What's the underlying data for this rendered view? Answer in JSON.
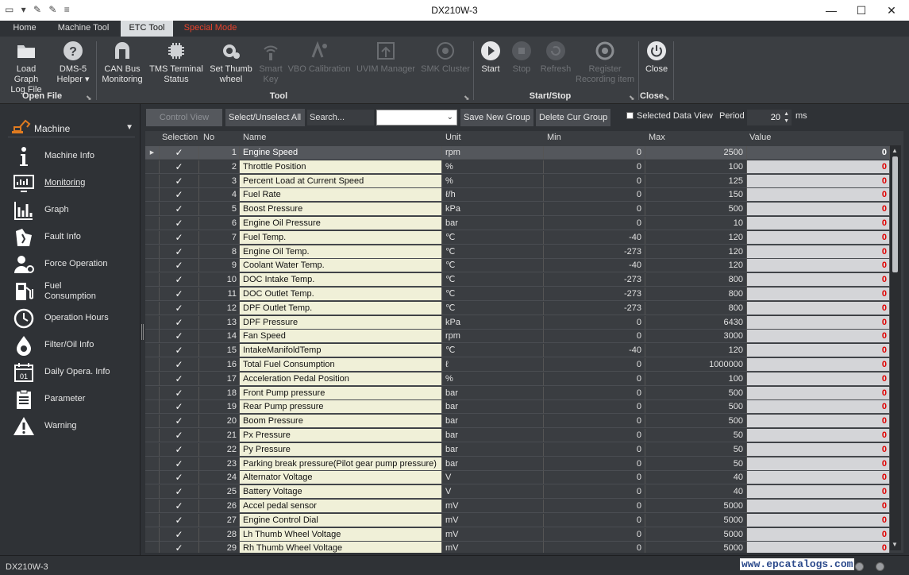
{
  "window": {
    "title": "DX210W-3"
  },
  "tabs": [
    {
      "label": "Home"
    },
    {
      "label": "Machine Tool"
    },
    {
      "label": "ETC Tool"
    },
    {
      "label": "Special Mode"
    }
  ],
  "ribbon": {
    "load_graph": "Load Graph",
    "log_file": "Log File",
    "dms5": "DMS-5",
    "helper": "Helper ▾",
    "can_bus": "CAN Bus",
    "monitoring": "Monitoring",
    "tms_terminal": "TMS Terminal",
    "status": "Status",
    "set_thumb": "Set Thumb",
    "wheel": "wheel",
    "smart": "Smart",
    "key": "Key",
    "vbo_calibration": "VBO Calibration",
    "uvim_manager": "UVIM Manager",
    "smk_cluster": "SMK Cluster",
    "start": "Start",
    "stop": "Stop",
    "refresh": "Refresh",
    "register": "Register",
    "recording_item": "Recording item",
    "close": "Close",
    "group_open_file": "Open File",
    "group_tool": "Tool",
    "group_start_stop": "Start/Stop",
    "group_close": "Close"
  },
  "sidebar": {
    "header": "Machine",
    "items": [
      {
        "label": "Machine Info",
        "icon": "info-icon"
      },
      {
        "label": "Monitoring",
        "icon": "monitor-icon"
      },
      {
        "label": "Graph",
        "icon": "graph-icon"
      },
      {
        "label": "Fault Info",
        "icon": "fault-icon"
      },
      {
        "label": "Force Operation",
        "icon": "user-gear-icon"
      },
      {
        "label": "Fuel",
        "label2": "Consumption",
        "icon": "fuel-icon"
      },
      {
        "label": "Operation Hours",
        "icon": "clock-icon"
      },
      {
        "label": "Filter/Oil Info",
        "icon": "oil-drop-icon"
      },
      {
        "label": "Daily Opera. Info",
        "icon": "calendar-icon"
      },
      {
        "label": "Parameter",
        "icon": "clipboard-icon"
      },
      {
        "label": "Warning",
        "icon": "warning-icon"
      }
    ]
  },
  "toolbar": {
    "control_view": "Control View",
    "select_all": "Select/Unselect All",
    "search_placeholder": "Search...",
    "save_group": "Save New Group",
    "delete_group": "Delete Cur Group",
    "selected_data_view": "Selected Data View",
    "period_label": "Period",
    "period_value": "20",
    "period_unit": "ms"
  },
  "grid": {
    "headers": {
      "selection": "Selection",
      "no": "No",
      "name": "Name",
      "unit": "Unit",
      "min": "Min",
      "max": "Max",
      "value": "Value"
    },
    "check": "✓",
    "rows": [
      {
        "no": "1",
        "name": "Engine Speed",
        "unit": "rpm",
        "min": "0",
        "max": "2500",
        "value": "0"
      },
      {
        "no": "2",
        "name": "Throttle Position",
        "unit": "%",
        "min": "0",
        "max": "100",
        "value": "0"
      },
      {
        "no": "3",
        "name": "Percent Load at Current Speed",
        "unit": "%",
        "min": "0",
        "max": "125",
        "value": "0"
      },
      {
        "no": "4",
        "name": "Fuel Rate",
        "unit": "ℓ/h",
        "min": "0",
        "max": "150",
        "value": "0"
      },
      {
        "no": "5",
        "name": "Boost Pressure",
        "unit": "kPa",
        "min": "0",
        "max": "500",
        "value": "0"
      },
      {
        "no": "6",
        "name": "Engine Oil Pressure",
        "unit": "bar",
        "min": "0",
        "max": "10",
        "value": "0"
      },
      {
        "no": "7",
        "name": "Fuel Temp.",
        "unit": "℃",
        "min": "-40",
        "max": "120",
        "value": "0"
      },
      {
        "no": "8",
        "name": "Engine Oil Temp.",
        "unit": "℃",
        "min": "-273",
        "max": "120",
        "value": "0"
      },
      {
        "no": "9",
        "name": "Coolant Water Temp.",
        "unit": "℃",
        "min": "-40",
        "max": "120",
        "value": "0"
      },
      {
        "no": "10",
        "name": "DOC Intake Temp.",
        "unit": "℃",
        "min": "-273",
        "max": "800",
        "value": "0"
      },
      {
        "no": "11",
        "name": "DOC Outlet Temp.",
        "unit": "℃",
        "min": "-273",
        "max": "800",
        "value": "0"
      },
      {
        "no": "12",
        "name": "DPF Outlet Temp.",
        "unit": "℃",
        "min": "-273",
        "max": "800",
        "value": "0"
      },
      {
        "no": "13",
        "name": "DPF Pressure",
        "unit": "kPa",
        "min": "0",
        "max": "6430",
        "value": "0"
      },
      {
        "no": "14",
        "name": "Fan Speed",
        "unit": "rpm",
        "min": "0",
        "max": "3000",
        "value": "0"
      },
      {
        "no": "15",
        "name": "IntakeManifoldTemp",
        "unit": "℃",
        "min": "-40",
        "max": "120",
        "value": "0"
      },
      {
        "no": "16",
        "name": "Total Fuel Consumption",
        "unit": "ℓ",
        "min": "0",
        "max": "1000000",
        "value": "0"
      },
      {
        "no": "17",
        "name": "Acceleration Pedal Position",
        "unit": "%",
        "min": "0",
        "max": "100",
        "value": "0"
      },
      {
        "no": "18",
        "name": "Front Pump pressure",
        "unit": "bar",
        "min": "0",
        "max": "500",
        "value": "0"
      },
      {
        "no": "19",
        "name": "Rear Pump pressure",
        "unit": "bar",
        "min": "0",
        "max": "500",
        "value": "0"
      },
      {
        "no": "20",
        "name": "Boom Pressure",
        "unit": "bar",
        "min": "0",
        "max": "500",
        "value": "0"
      },
      {
        "no": "21",
        "name": "Px Pressure",
        "unit": "bar",
        "min": "0",
        "max": "50",
        "value": "0"
      },
      {
        "no": "22",
        "name": "Py Pressure",
        "unit": "bar",
        "min": "0",
        "max": "50",
        "value": "0"
      },
      {
        "no": "23",
        "name": "Parking break pressure(Pilot gear pump pressure)",
        "unit": "bar",
        "min": "0",
        "max": "50",
        "value": "0"
      },
      {
        "no": "24",
        "name": "Alternator Voltage",
        "unit": "V",
        "min": "0",
        "max": "40",
        "value": "0"
      },
      {
        "no": "25",
        "name": "Battery Voltage",
        "unit": "V",
        "min": "0",
        "max": "40",
        "value": "0"
      },
      {
        "no": "26",
        "name": "Accel pedal sensor",
        "unit": "mV",
        "min": "0",
        "max": "5000",
        "value": "0"
      },
      {
        "no": "27",
        "name": "Engine Control Dial",
        "unit": "mV",
        "min": "0",
        "max": "5000",
        "value": "0"
      },
      {
        "no": "28",
        "name": "Lh Thumb Wheel Voltage",
        "unit": "mV",
        "min": "0",
        "max": "5000",
        "value": "0"
      },
      {
        "no": "29",
        "name": "Rh Thumb Wheel Voltage",
        "unit": "mV",
        "min": "0",
        "max": "5000",
        "value": "0"
      }
    ]
  },
  "status": {
    "text": "DX210W-3",
    "watermark": "www.epcatalogs.com"
  },
  "colors": {
    "accent_red": "#e8432c",
    "value_red": "#e00000",
    "name_bg": "#f0f0d8"
  }
}
